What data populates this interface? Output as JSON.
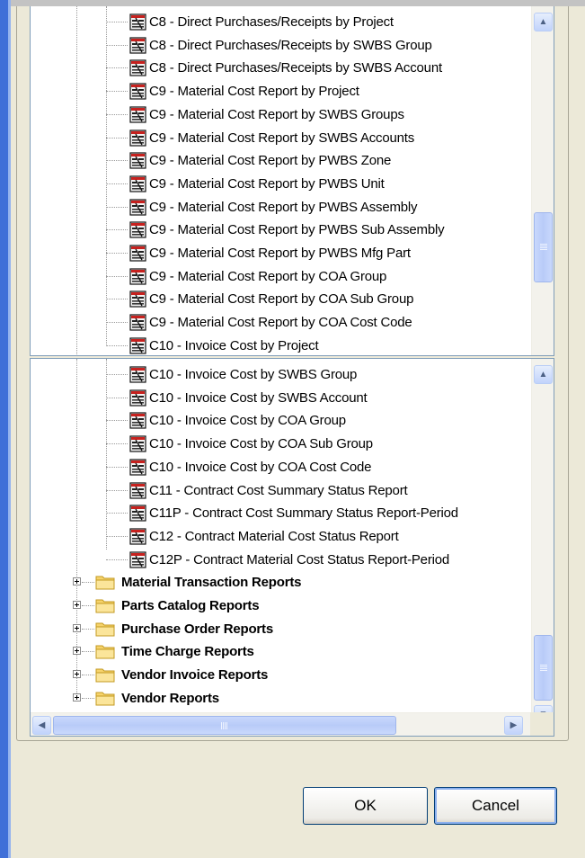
{
  "top_pane": {
    "items": [
      "C8 - Direct Purchases/Receipts by Project",
      "C8 - Direct Purchases/Receipts by SWBS Group",
      "C8 - Direct Purchases/Receipts by SWBS Account",
      "C9 - Material Cost Report by Project",
      "C9 - Material Cost Report by SWBS Groups",
      "C9 - Material Cost Report by SWBS Accounts",
      "C9 - Material Cost Report by PWBS Zone",
      "C9 - Material Cost Report by PWBS Unit",
      "C9 - Material Cost Report by PWBS Assembly",
      "C9 - Material Cost Report by PWBS Sub Assembly",
      "C9 - Material Cost Report by PWBS Mfg Part",
      "C9 - Material Cost Report  by COA Group",
      "C9 - Material Cost Report by COA Sub Group",
      "C9 - Material Cost Report by COA Cost Code",
      "C10 - Invoice Cost by Project"
    ]
  },
  "bottom_pane": {
    "items": [
      "C10 - Invoice Cost by SWBS Group",
      "C10 - Invoice Cost by SWBS Account",
      "C10 - Invoice Cost by COA Group",
      "C10 - Invoice Cost by COA Sub Group",
      "C10 - Invoice Cost by COA Cost Code",
      "C11 - Contract Cost Summary Status Report",
      "C11P - Contract Cost Summary Status Report-Period",
      "C12 - Contract Material Cost Status Report",
      "C12P - Contract Material Cost Status Report-Period"
    ],
    "folders": [
      "Material Transaction Reports",
      "Parts Catalog Reports",
      "Purchase Order Reports",
      "Time Charge Reports",
      "Vendor Invoice Reports",
      "Vendor Reports"
    ]
  },
  "buttons": {
    "ok": "OK",
    "cancel": "Cancel"
  },
  "icons": {
    "report": "report-icon",
    "folder": "folder-icon",
    "expand": "plus-expand-icon"
  },
  "colors": {
    "window_bg": "#ECE9D8",
    "accent_blue": "#3f6fd8",
    "pane_border": "#7f9db9",
    "folder_yellow": "#f6d36b"
  }
}
